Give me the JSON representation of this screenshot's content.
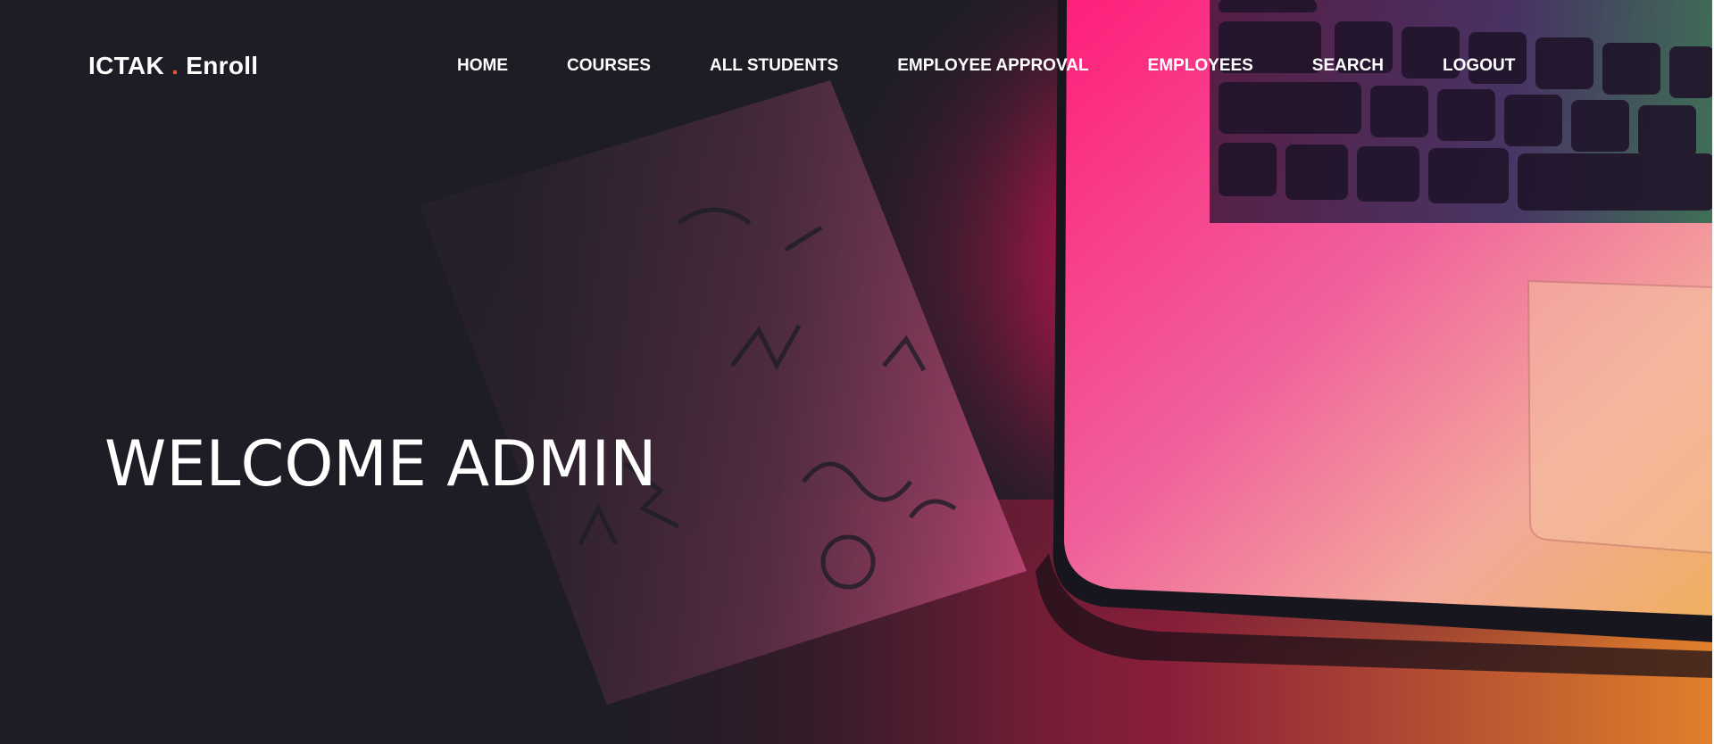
{
  "brand": {
    "name_left": "ICTAK",
    "separator": ".",
    "name_right": "Enroll",
    "separator_color": "#e8503a"
  },
  "nav": {
    "items": [
      {
        "label": "HOME"
      },
      {
        "label": "COURSES"
      },
      {
        "label": "ALL STUDENTS"
      },
      {
        "label": "EMPLOYEE APPROVAL"
      },
      {
        "label": "EMPLOYEES"
      },
      {
        "label": "SEARCH"
      },
      {
        "label": "LOGOUT"
      }
    ]
  },
  "hero": {
    "heading": "WELCOME ADMIN"
  },
  "colors": {
    "base_dark": "#1e1d26",
    "accent_pink": "#e0176a",
    "accent_orange": "#e8a030"
  }
}
